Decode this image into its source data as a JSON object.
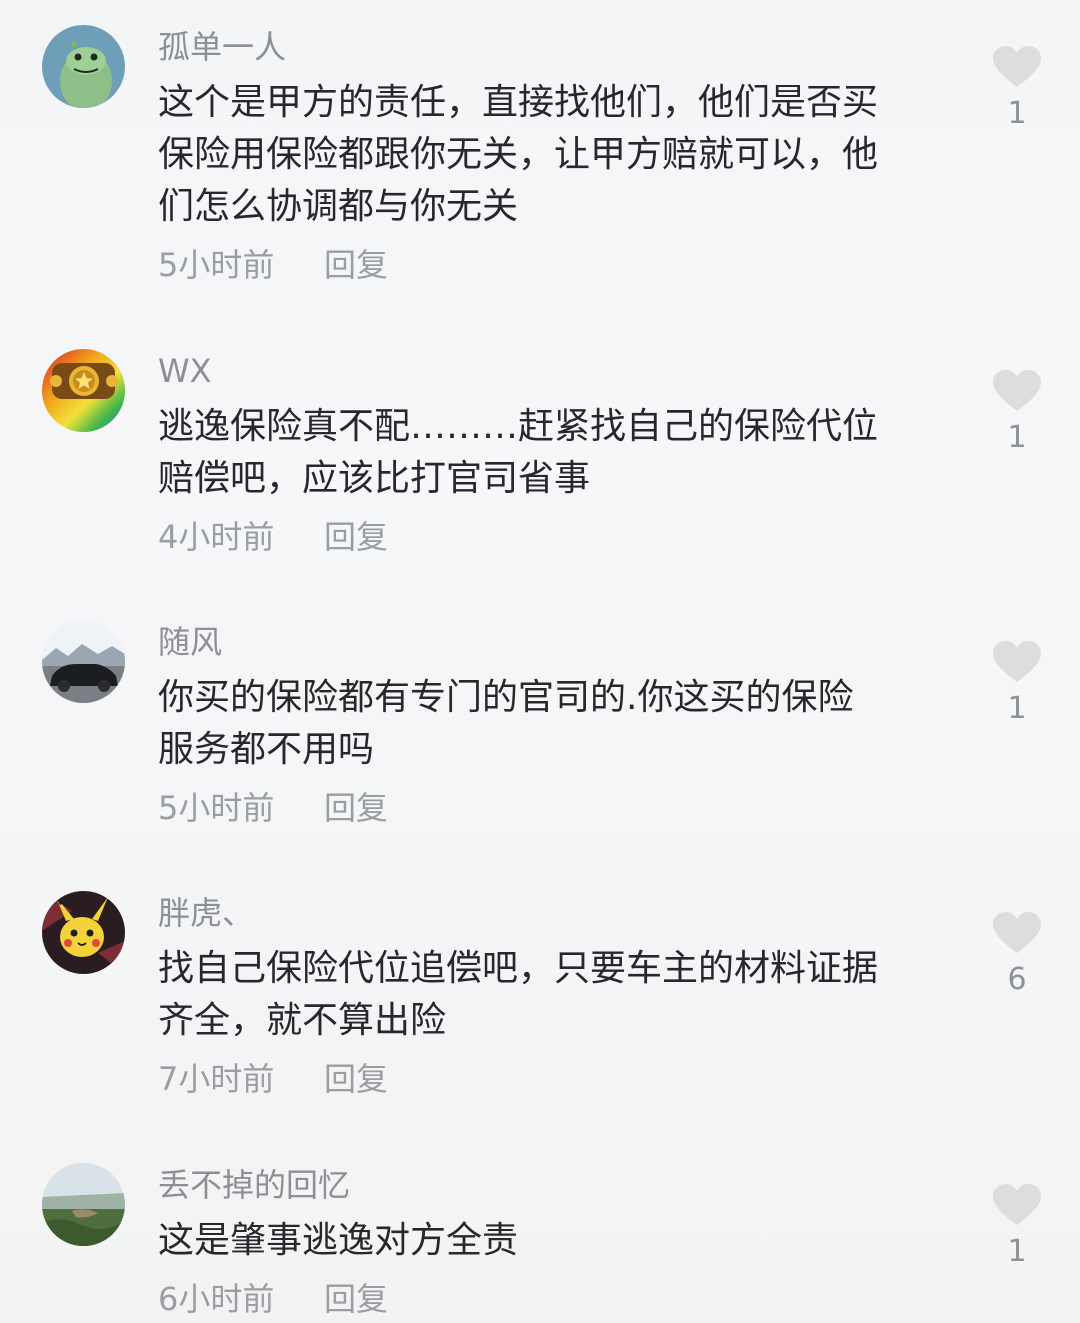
{
  "comments": [
    {
      "user": "孤单一人",
      "text": "这个是甲方的责任，直接找他们，他们是否买\n保险用保险都跟你无关，让甲方赔就可以，他\n们怎么协调都与你无关",
      "time": "5小时前",
      "reply_label": "回复",
      "likes": "1"
    },
    {
      "user": "WX",
      "text": "逃逸保险真不配………赶紧找自己的保险代位\n赔偿吧，应该比打官司省事",
      "time": "4小时前",
      "reply_label": "回复",
      "likes": "1"
    },
    {
      "user": "随风",
      "text": "你买的保险都有专门的官司的.你这买的保险\n服务都不用吗",
      "time": "5小时前",
      "reply_label": "回复",
      "likes": "1"
    },
    {
      "user": "胖虎、",
      "text": "找自己保险代位追偿吧，只要车主的材料证据\n齐全，就不算出险",
      "time": "7小时前",
      "reply_label": "回复",
      "likes": "6"
    },
    {
      "user": "丢不掉的回忆",
      "text": "这是肇事逃逸对方全责",
      "time": "6小时前",
      "reply_label": "回复",
      "likes": "1"
    }
  ],
  "icons": {
    "like": "heart-icon",
    "like_color": "#dcdddf"
  }
}
